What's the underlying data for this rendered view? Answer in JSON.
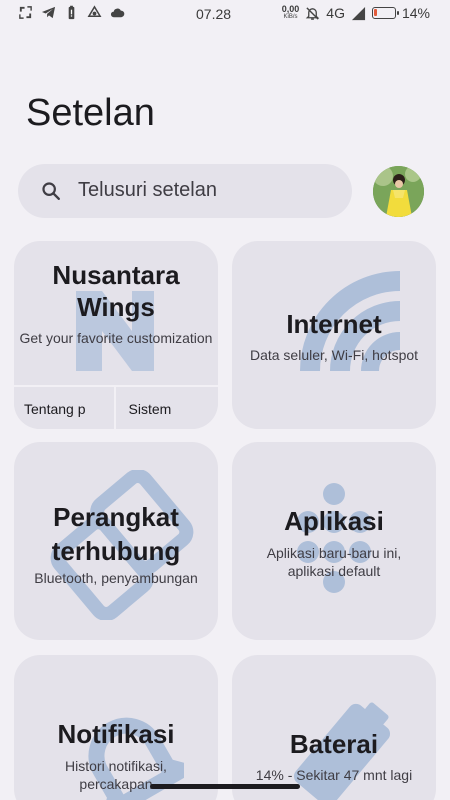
{
  "status_bar": {
    "time": "07.28",
    "net_speed": "0,00",
    "net_unit": "KiB/s",
    "network": "4G",
    "battery_pct": "14%",
    "battery_level": 0.14
  },
  "header": {
    "title": "Setelan"
  },
  "search": {
    "placeholder": "Telusuri setelan"
  },
  "cards": {
    "nusantara": {
      "title": "Nusantara Wings",
      "subtitle": "Get your favorite customization",
      "tab_about": "Tentang p",
      "tab_system": "Sistem"
    },
    "internet": {
      "title": "Internet",
      "subtitle": "Data seluler, Wi-Fi, hotspot"
    },
    "devices": {
      "title": "Perangkat terhubung",
      "subtitle": "Bluetooth, penyambungan"
    },
    "apps": {
      "title": "Aplikasi",
      "subtitle": "Aplikasi baru-baru ini, aplikasi default"
    },
    "notifications": {
      "title": "Notifikasi",
      "subtitle": "Histori notifikasi, percakapan"
    },
    "battery": {
      "title": "Baterai",
      "subtitle": "14% - Sekitar 47 mnt lagi"
    }
  },
  "icons": {
    "search": "search-icon",
    "avatar": "profile-avatar"
  },
  "colors": {
    "background": "#f2f0f5",
    "card": "#e4e2ea",
    "watermark": "#aebfd9",
    "battery_low": "#e25a3a"
  }
}
